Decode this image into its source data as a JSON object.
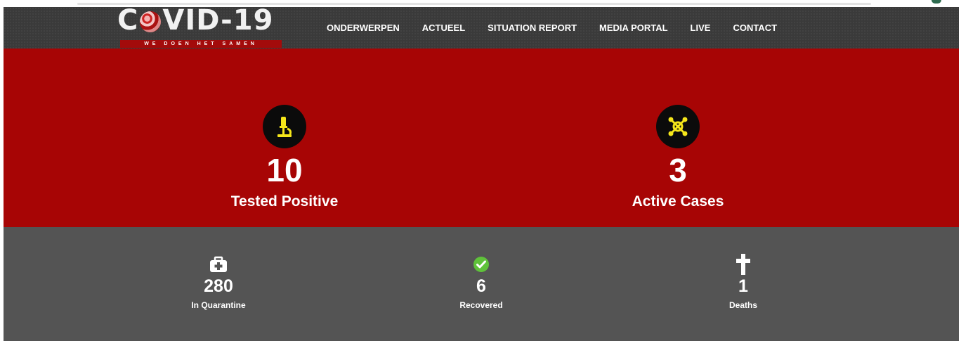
{
  "brand": {
    "title_left": "C",
    "title_right": "VID-19",
    "tagline": "WE DOEN HET SAMEN"
  },
  "nav": {
    "items": [
      {
        "label": "ONDERWERPEN"
      },
      {
        "label": "ACTUEEL"
      },
      {
        "label": "SITUATION REPORT"
      },
      {
        "label": "MEDIA PORTAL"
      },
      {
        "label": "LIVE"
      },
      {
        "label": "CONTACT"
      }
    ]
  },
  "primary_stats": [
    {
      "value": "10",
      "label": "Tested Positive",
      "icon": "microscope-icon"
    },
    {
      "value": "3",
      "label": "Active Cases",
      "icon": "virus-molecule-icon"
    }
  ],
  "secondary_stats": [
    {
      "value": "280",
      "label": "In Quarantine",
      "icon": "medical-kit-icon"
    },
    {
      "value": "6",
      "label": "Recovered",
      "icon": "check-circle-icon"
    },
    {
      "value": "1",
      "label": "Deaths",
      "icon": "cross-icon"
    }
  ],
  "colors": {
    "header_bg": "#3a3a3a",
    "primary_panel": "#a70505",
    "secondary_panel": "#545454",
    "accent_yellow": "#f5e61a",
    "check_green": "#5fc23a"
  }
}
